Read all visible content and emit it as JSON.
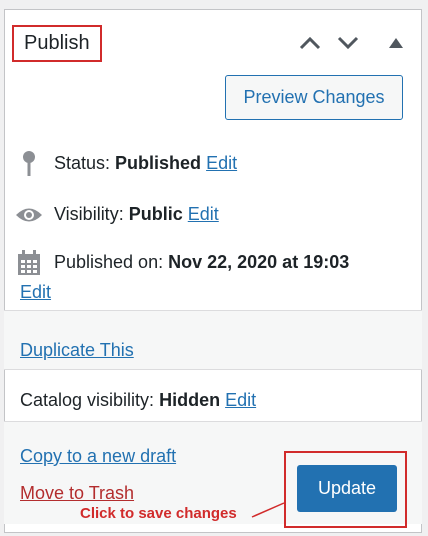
{
  "header": {
    "title": "Publish",
    "icons": [
      "chevron-up-icon",
      "chevron-down-icon",
      "triangle-up-icon"
    ]
  },
  "preview_button": "Preview Changes",
  "status": {
    "label": "Status:",
    "value": "Published",
    "edit": "Edit",
    "icon": "pin-icon"
  },
  "visibility": {
    "label": "Visibility:",
    "value": "Public",
    "edit": "Edit",
    "icon": "eye-icon"
  },
  "published_on": {
    "label": "Published on:",
    "value": "Nov 22, 2020 at 19:03",
    "edit": "Edit",
    "icon": "calendar-icon"
  },
  "duplicate": {
    "link": "Duplicate This"
  },
  "catalog": {
    "label": "Catalog visibility:",
    "value": "Hidden",
    "edit": "Edit"
  },
  "footer": {
    "copy_draft": "Copy to a new draft",
    "trash": "Move to Trash",
    "update_button": "Update",
    "annotation": "Click to save changes"
  },
  "colors": {
    "accent": "#2271b1",
    "annotation": "#d12b2b",
    "trash": "#b32d2e"
  }
}
